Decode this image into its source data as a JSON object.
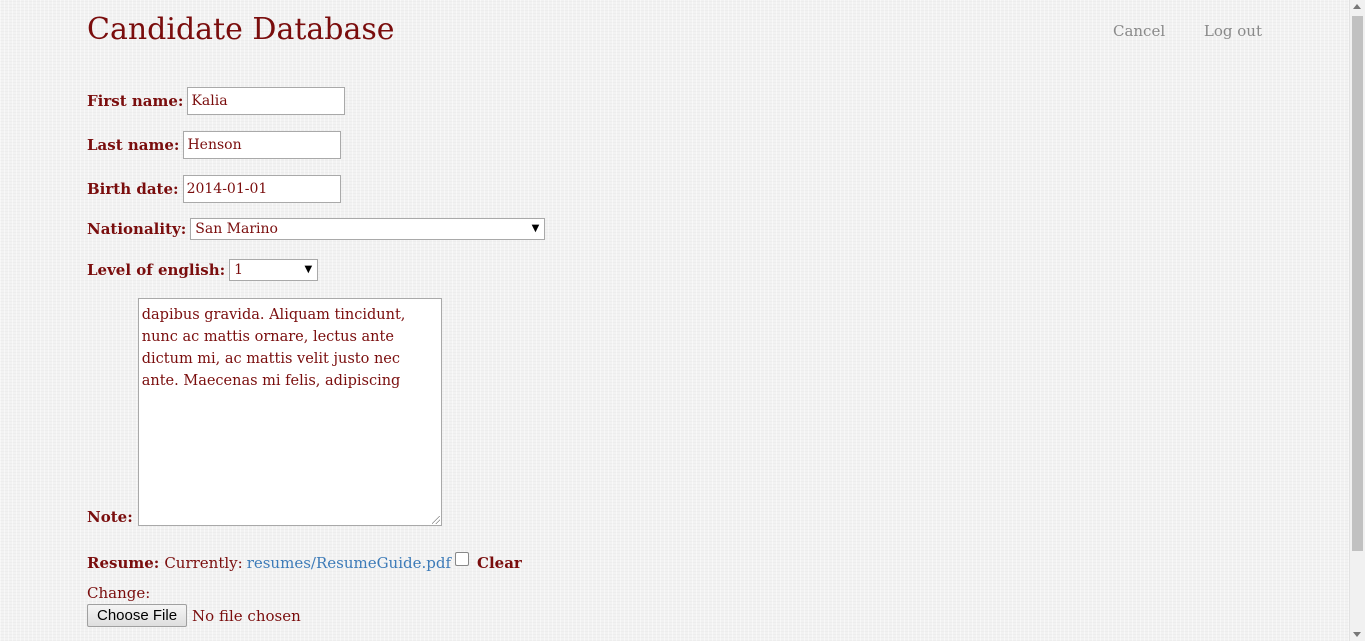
{
  "header": {
    "title": "Candidate Database",
    "nav": {
      "cancel": "Cancel",
      "logout": "Log out"
    }
  },
  "form": {
    "first_name": {
      "label": "First name:",
      "value": "Kalia"
    },
    "last_name": {
      "label": "Last name:",
      "value": "Henson"
    },
    "birth_date": {
      "label": "Birth date:",
      "value": "2014-01-01"
    },
    "nationality": {
      "label": "Nationality:",
      "value": "San Marino"
    },
    "english_level": {
      "label": "Level of english:",
      "value": "1"
    },
    "note": {
      "label": "Note:",
      "value": "dapibus gravida. Aliquam tincidunt, nunc ac mattis ornare, lectus ante dictum mi, ac mattis velit justo nec ante. Maecenas mi felis, adipiscing"
    },
    "resume": {
      "label": "Resume:",
      "currently": "Currently:",
      "file_link": "resumes/ResumeGuide.pdf",
      "clear_label": "Clear",
      "change_label": "Change:",
      "choose_button": "Choose File",
      "no_file": "No file chosen"
    }
  }
}
